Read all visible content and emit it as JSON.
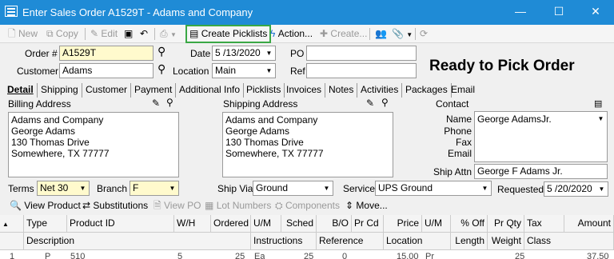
{
  "window": {
    "title": "Enter Sales Order A1529T - Adams and Company",
    "minimize": "—",
    "maximize": "☐",
    "close": "✕"
  },
  "toolbar": {
    "new": "New",
    "copy": "Copy",
    "edit": "Edit",
    "create_picklists": "Create Picklists",
    "action": "Action...",
    "create": "Create..."
  },
  "header": {
    "order_label": "Order #",
    "order_value": "A1529T",
    "date_label": "Date",
    "date_value": "5 /13/2020",
    "po_label": "PO",
    "po_value": "",
    "customer_label": "Customer",
    "customer_value": "Adams",
    "location_label": "Location",
    "location_value": "Main",
    "ref_label": "Ref",
    "ref_value": "",
    "status_text": "Ready to Pick Order"
  },
  "tabs": [
    "Detail",
    "Shipping",
    "Customer",
    "Payment",
    "Additional Info",
    "Picklists",
    "Invoices",
    "Notes",
    "Activities",
    "Packages",
    "Email"
  ],
  "billing": {
    "label": "Billing Address",
    "lines": "Adams and Company\nGeorge Adams\n130 Thomas Drive\nSomewhere, TX 77777"
  },
  "shipping": {
    "label": "Shipping Address",
    "lines": "Adams and Company\nGeorge Adams\n130 Thomas Drive\nSomewhere, TX 77777"
  },
  "contact": {
    "label": "Contact",
    "name_label": "Name",
    "name_value": "George AdamsJr.",
    "phone_label": "Phone",
    "fax_label": "Fax",
    "email_label": "Email",
    "shipattn_label": "Ship Attn",
    "shipattn_value": "George F Adams Jr."
  },
  "terms": {
    "terms_label": "Terms",
    "terms_value": "Net 30",
    "branch_label": "Branch",
    "branch_value": "F",
    "shipvia_label": "Ship Via",
    "shipvia_value": "Ground",
    "service_label": "Service",
    "service_value": "UPS Ground",
    "requested_label": "Requested",
    "requested_value": "5 /20/2020"
  },
  "subtoolbar": {
    "view_product": "View Product",
    "substitutions": "Substitutions",
    "view_po": "View PO",
    "lot_numbers": "Lot Numbers",
    "components": "Components",
    "move": "Move..."
  },
  "grid": {
    "header1": [
      "Type",
      "Product ID",
      "W/H",
      "Ordered",
      "U/M",
      "Sched",
      "B/O",
      "Pr Cd",
      "Price",
      "U/M",
      "% Off",
      "Pr Qty",
      "Tax",
      "Amount"
    ],
    "header2": [
      "Description",
      "Instructions",
      "Reference",
      "Location",
      "Length",
      "Weight",
      "Class"
    ],
    "partial_row": [
      "1",
      "P",
      "510",
      "5",
      "25",
      "Ea",
      "25",
      "0",
      "15.00",
      "Pr",
      "25",
      "37.50"
    ]
  },
  "colors": {
    "titlebar": "#1f8bd6",
    "highlight": "#3aa845",
    "order_field": "#fffacd"
  }
}
